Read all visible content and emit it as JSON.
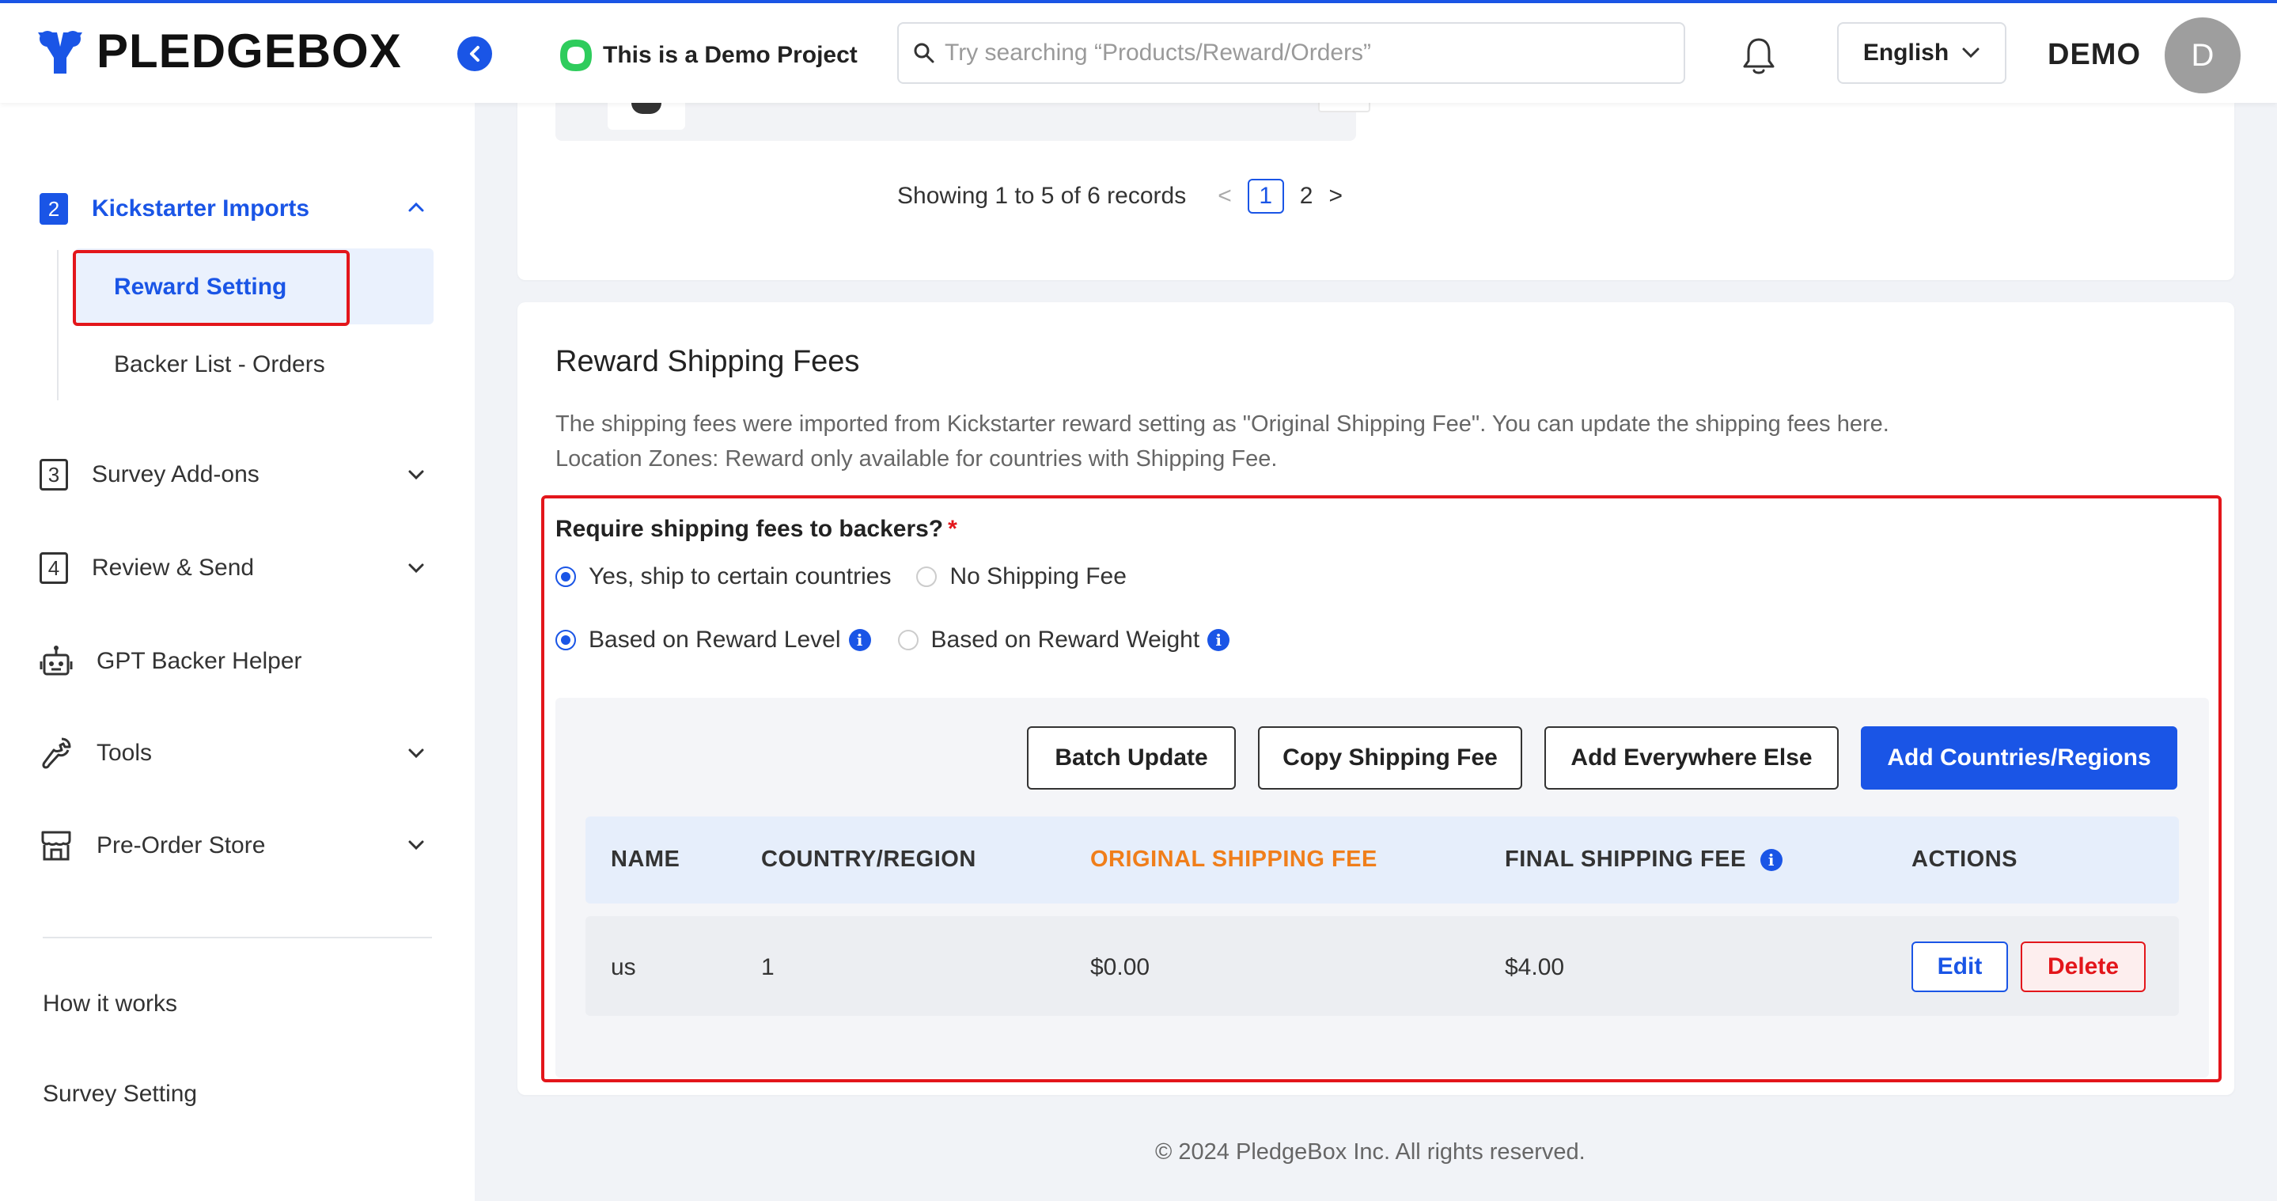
{
  "header": {
    "logo_text": "PLEDGEBOX",
    "project_label": "This is a Demo Project",
    "search_placeholder": "Try searching “Products/Reward/Orders”",
    "language": "English",
    "username": "DEMO",
    "avatar_initial": "D"
  },
  "sidebar": {
    "sections": [
      {
        "number": "2",
        "label": "Kickstarter Imports",
        "active": true
      },
      {
        "number": "3",
        "label": "Survey Add-ons"
      },
      {
        "number": "4",
        "label": "Review & Send"
      }
    ],
    "sub_items": [
      {
        "label": "Reward Setting",
        "active": true
      },
      {
        "label": "Backer List - Orders"
      }
    ],
    "tools": [
      {
        "icon": "robot-icon",
        "label": "GPT Backer Helper"
      },
      {
        "icon": "wrench-icon",
        "label": "Tools"
      },
      {
        "icon": "store-icon",
        "label": "Pre-Order Store"
      }
    ],
    "links": [
      "How it works",
      "Survey Setting"
    ]
  },
  "pagination": {
    "info": "Showing 1 to 5 of 6 records",
    "pages": [
      "1",
      "2"
    ],
    "current": "1"
  },
  "shipping": {
    "title": "Reward Shipping Fees",
    "description_line1": "The shipping fees were imported from Kickstarter reward setting as \"Original Shipping Fee\". You can update the shipping fees here.",
    "description_line2": "Location Zones: Reward only available for countries with Shipping Fee.",
    "question": "Require shipping fees to backers?",
    "required_mark": "*",
    "option_yes": "Yes, ship to certain countries",
    "option_no": "No Shipping Fee",
    "option_level": "Based on Reward Level",
    "option_weight": "Based on Reward Weight",
    "buttons": {
      "batch_update": "Batch Update",
      "copy_fee": "Copy Shipping Fee",
      "add_everywhere": "Add Everywhere Else",
      "add_countries": "Add Countries/Regions"
    },
    "columns": {
      "name": "NAME",
      "country": "COUNTRY/REGION",
      "original_fee": "ORIGINAL SHIPPING FEE",
      "final_fee": "FINAL SHIPPING FEE",
      "actions": "ACTIONS"
    },
    "rows": [
      {
        "name": "us",
        "country": "1",
        "original_fee": "$0.00",
        "final_fee": "$4.00",
        "edit": "Edit",
        "delete": "Delete"
      }
    ]
  },
  "footer": "© 2024 PledgeBox Inc. All rights reserved.",
  "colors": {
    "accent": "#1a55e6",
    "highlight_red": "#e3161b",
    "orange": "#f07e1a"
  }
}
